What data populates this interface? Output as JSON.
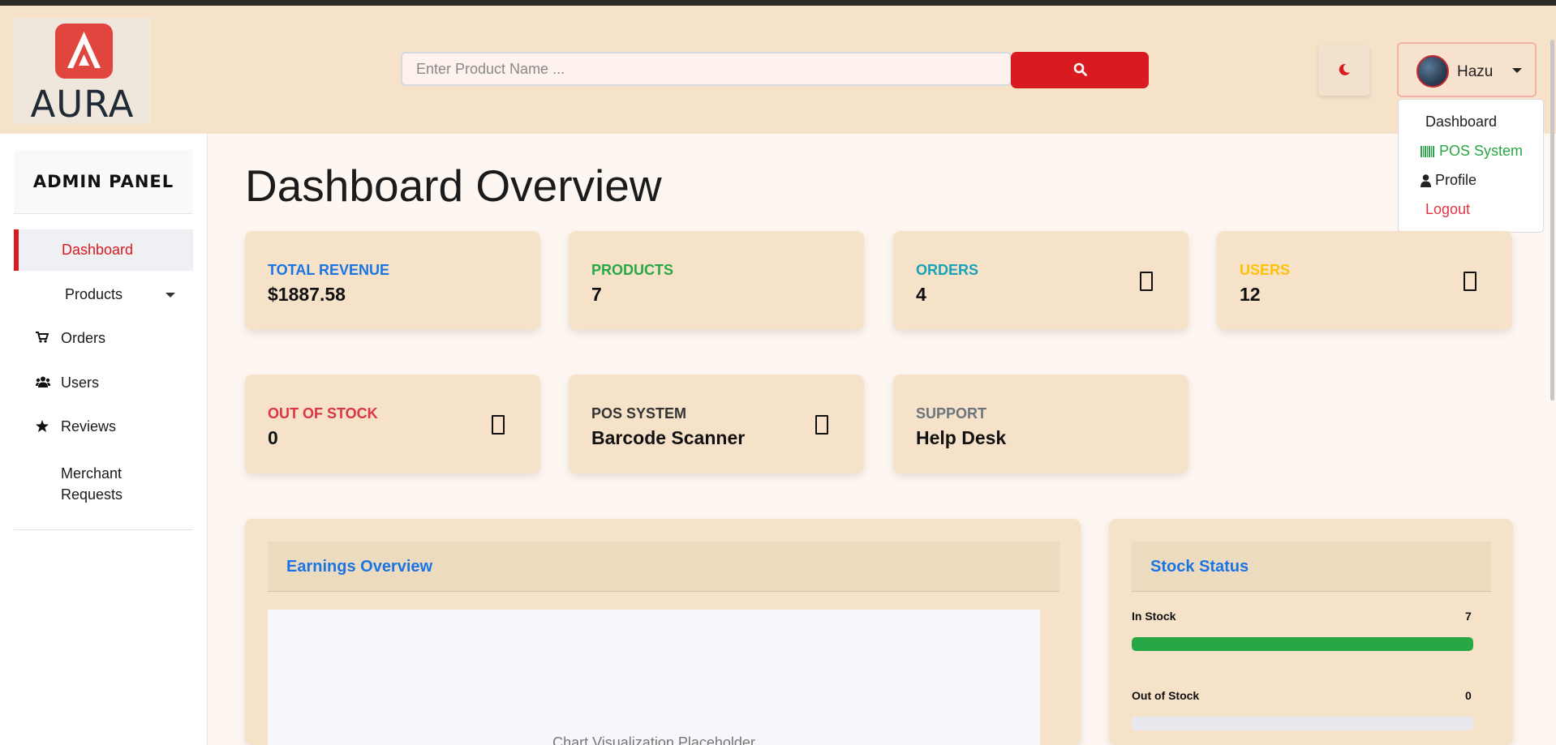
{
  "header": {
    "logo_text": "AURA",
    "search_placeholder": "Enter Product Name ...",
    "user_name": "Hazu"
  },
  "user_menu": {
    "items": [
      {
        "label": "Dashboard"
      },
      {
        "label": "POS System",
        "icon": "barcode-icon"
      },
      {
        "label": "Profile",
        "icon": "user-icon"
      },
      {
        "label": "Logout"
      }
    ]
  },
  "sidebar": {
    "brand": "ADMIN PANEL",
    "items": [
      {
        "label": "Dashboard",
        "active": true
      },
      {
        "label": "Products",
        "icon": "chevron-down-icon"
      },
      {
        "label": "Orders",
        "icon": "cart-icon"
      },
      {
        "label": "Users",
        "icon": "users-icon"
      },
      {
        "label": "Reviews",
        "icon": "star-icon"
      },
      {
        "label": "Merchant Requests"
      }
    ]
  },
  "main": {
    "title": "Dashboard Overview",
    "cards": [
      {
        "label": "TOTAL REVENUE",
        "value": "$1887.58",
        "color": "#1b74e4"
      },
      {
        "label": "PRODUCTS",
        "value": "7",
        "color": "#28a745"
      },
      {
        "label": "ORDERS",
        "value": "4",
        "color": "#17a2b8"
      },
      {
        "label": "USERS",
        "value": "12",
        "color": "#ffc107"
      },
      {
        "label": "OUT OF STOCK",
        "value": "0",
        "color": "#dc3545"
      },
      {
        "label": "POS SYSTEM",
        "value": "Barcode Scanner",
        "color": "#333333"
      },
      {
        "label": "SUPPORT",
        "value": "Help Desk",
        "color": "#6c757d"
      }
    ],
    "earnings": {
      "title": "Earnings Overview",
      "placeholder": "Chart Visualization Placeholder"
    },
    "stock": {
      "title": "Stock Status",
      "rows": [
        {
          "label": "In Stock",
          "value": "7",
          "fraction": 1.0
        },
        {
          "label": "Out of Stock",
          "value": "0",
          "fraction": 0.0
        }
      ]
    }
  },
  "colors": {
    "accent": "#d81b21",
    "header_bg": "#f5e2c9",
    "page_bg": "#fef6f0"
  }
}
